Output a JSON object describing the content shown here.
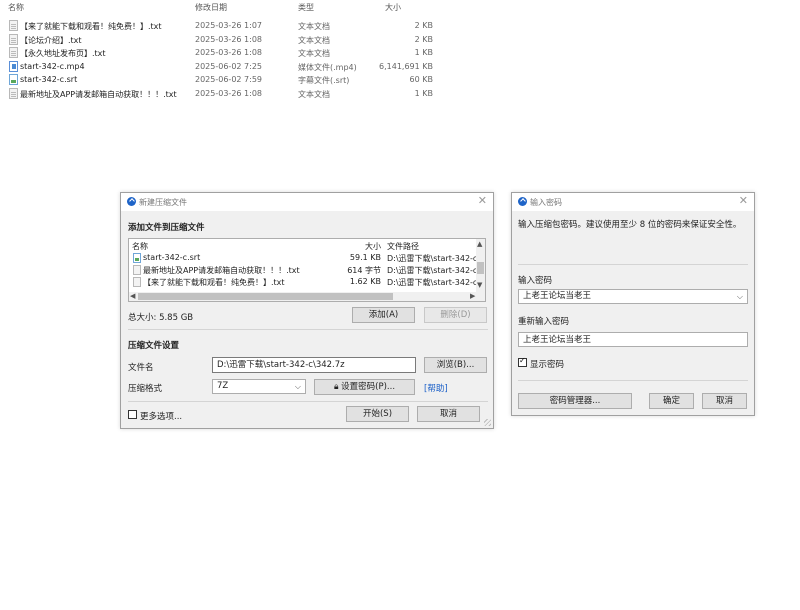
{
  "explorer": {
    "headers": {
      "name": "名称",
      "date": "修改日期",
      "type": "类型",
      "size": "大小"
    },
    "rows": [
      {
        "icon": "txt-file-icon",
        "name": "【来了就能下载和观看！纯免费！】.txt",
        "date": "2025-03-26 1:07",
        "type": "文本文档",
        "size": "2 KB"
      },
      {
        "icon": "txt-file-icon",
        "name": "【论坛介绍】.txt",
        "date": "2025-03-26 1:08",
        "type": "文本文档",
        "size": "2 KB"
      },
      {
        "icon": "txt-file-icon",
        "name": "【永久地址发布页】.txt",
        "date": "2025-03-26 1:08",
        "type": "文本文档",
        "size": "1 KB"
      },
      {
        "icon": "video-file-icon",
        "name": "start-342-c.mp4",
        "date": "2025-06-02 7:25",
        "type": "媒体文件(.mp4)",
        "size": "6,141,691 KB"
      },
      {
        "icon": "subtitle-file-icon",
        "name": "start-342-c.srt",
        "date": "2025-06-02 7:59",
        "type": "字幕文件(.srt)",
        "size": "60 KB"
      },
      {
        "icon": "txt-file-icon",
        "name": "最新地址及APP请发邮箱自动获取！！！.txt",
        "date": "2025-03-26 1:08",
        "type": "文本文档",
        "size": "1 KB"
      }
    ]
  },
  "zip_dialog": {
    "title": "新建压缩文件",
    "add_section": "添加文件到压缩文件",
    "table_headers": {
      "name": "名称",
      "size": "大小",
      "path": "文件路径"
    },
    "files": [
      {
        "icon": "subtitle-file-icon",
        "name": "start-342-c.srt",
        "size": "59.1 KB",
        "path": "D:\\迅雷下载\\start-342-c"
      },
      {
        "icon": "txt-file-icon",
        "name": "最新地址及APP请发邮箱自动获取！！！.txt",
        "size": "614 字节",
        "path": "D:\\迅雷下载\\start-342-c"
      },
      {
        "icon": "txt-file-icon",
        "name": "【来了就能下载和观看！纯免费！】.txt",
        "size": "1.62 KB",
        "path": "D:\\迅雷下载\\start-342-c"
      }
    ],
    "total_size": "总大小: 5.85 GB",
    "add_button": "添加(A)",
    "delete_button": "删除(D)",
    "settings_section": "压缩文件设置",
    "filename_label": "文件名",
    "filename_value": "D:\\迅雷下载\\start-342-c\\342.7z",
    "browse_button": "浏览(B)...",
    "format_label": "压缩格式",
    "format_value": "7Z",
    "set_password_button": "设置密码(P)...",
    "help_link": "[帮助]",
    "more_options": "更多选项...",
    "start_button": "开始(S)",
    "cancel_button": "取消"
  },
  "password_dialog": {
    "title": "输入密码",
    "hint": "输入压缩包密码。建议使用至少 8 位的密码来保证安全性。",
    "password_label": "输入密码",
    "password_value": "上老王论坛当老王",
    "confirm_label": "重新输入密码",
    "confirm_value": "上老王论坛当老王",
    "show_password": "显示密码",
    "show_password_checked": true,
    "manager_button": "密码管理器...",
    "ok_button": "确定",
    "cancel_button": "取消"
  }
}
